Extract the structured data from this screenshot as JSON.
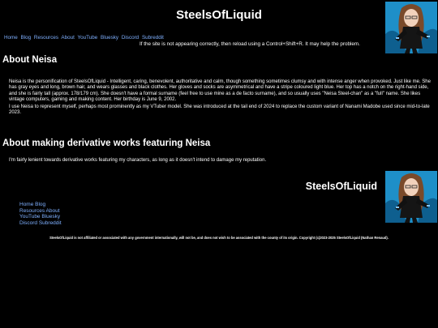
{
  "site": {
    "title": "SteelsOfLiquid"
  },
  "nav": {
    "items": [
      {
        "label": "Home"
      },
      {
        "label": "Blog"
      },
      {
        "label": "Resources"
      },
      {
        "label": "About"
      },
      {
        "label": "YouTube"
      },
      {
        "label": "Bluesky"
      },
      {
        "label": "Discord"
      },
      {
        "label": "Subreddit"
      }
    ]
  },
  "notice": "If the site is not appearing correctly, then reload using a Control+Shift+R. It may help the problem.",
  "about": {
    "heading": "About Neisa",
    "p1": "Neisa is the personification of SteelsOfLiquid - Intelligent, caring, benevolent, authoritative and calm, though something sometimes clumsy and with intense anger when provoked. Just like me. She has gray eyes and long, brown hair, and wears glasses and black clothes. Her gloves and socks are asymmetrical and have a stripe coloured light blue. Her top has a notch on the right-hand side, and she is fairly tall (approx. 178/179 cm). She doesn't have a formal surname (feel free to use mine as a de facto surname), and so usually uses \"Neisa Steel-chan\" as a \"full\" name. She likes vintage computers, gaming and making content. Her birthday is June 9, 2002.",
    "p2": "I use Neisa to represent myself, perhaps most prominently as my VTuber model. She was introduced at the tail end of 2024 to replace the custom variant of Nanami Madobe used since mid-to-late 2023."
  },
  "derivative": {
    "heading": "About making derivative works featuring Neisa",
    "p1": "I'm fairly lenient towards derivative works featuring my characters, as long as it doesn't intend to damage my reputation."
  },
  "footer": {
    "title": "SteelsOfLiquid",
    "links": [
      {
        "label": "Home Blog"
      },
      {
        "label": "Resources About"
      },
      {
        "label": "YouTube Bluesky"
      },
      {
        "label": "Discord Subreddit"
      }
    ],
    "disclaimer": "SteelsOfLiquid is not affiliated or associated with any government internationally, will not be, and does not wish to be associated with the county of its origin. Copyright (c)2023-2025 SteelsOfLiquid (Nathan Renaud)."
  },
  "colors": {
    "background": "#000000",
    "link": "#7fb0ff",
    "avatar_bg": "#1e8fc8"
  }
}
